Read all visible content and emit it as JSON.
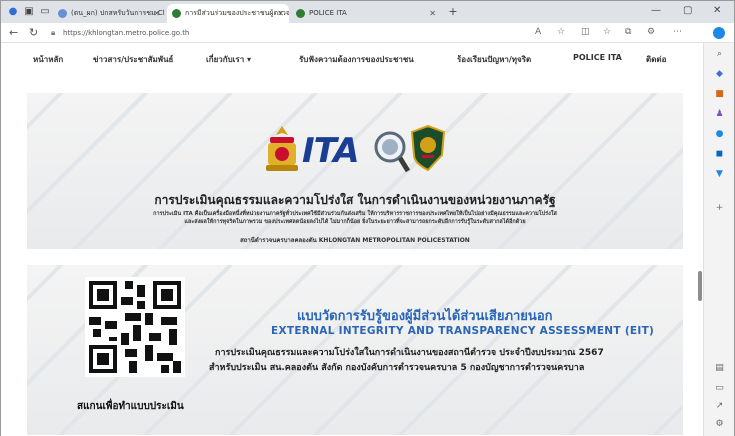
{
  "browser": {
    "tabs": [
      {
        "title": "(ตน_ผก) ปกสหรับวันการชม Cl:",
        "active": false,
        "favicon_color": "#6b8fd6"
      },
      {
        "title": "การมีส่วนร่วมของประชาชนผู้ตรวจสอบผล",
        "active": true,
        "favicon_color": "#2e7d32"
      },
      {
        "title": "POLICE ITA",
        "active": false,
        "favicon_color": "#2e7d32"
      }
    ],
    "url": "https://khlongtan.metro.police.go.th",
    "new_tab_symbol": "+"
  },
  "menu": {
    "items": [
      "หน้าหลัก",
      "ข่าวสาร/ประชาสัมพันธ์",
      "เกี่ยวกับเรา ▾",
      "รับฟังความต้องการของประชาชน",
      "ร้องเรียนปัญหา/ทุจริต",
      "POLICE ITA",
      "ติดต่อ"
    ]
  },
  "banner1": {
    "logo_text": "ITA",
    "title": "การประเมินคุณธรรมและความโปร่งใส ในการดำเนินงานของหน่วยงานภาครัฐ",
    "desc_line1": "การประเมิน ITA คือเป็นเครื่องมือหนึ่งที่หน่วยงานภาครัฐทั่วประเทศใช้มีส่วนร่วมกันส่งเสริม ให้การบริหารราชการของประเทศไทยให้เป็นไปอย่างมีคุณธรรมและความโปร่งใส",
    "desc_line2": "และส่งผลให้การทุจริตในภาพรวม ของประเทศลดน้อยลงไปได้ ไม่มากก็น้อย ยิ่งในระยะยาวที่จะสามารถยกระดับอีกการรับรู้ในระดับสากลได้อีกด้วย",
    "station": "สถานีตำรวจนครบาลคลองตัน   KHLONGTAN METROPOLITAN POLICESTATION"
  },
  "banner2": {
    "qr_caption": "สแกนเพื่อทำแบบประเมิน",
    "title_thai": "แบบวัดการรับรู้ของผู้มีส่วนได้ส่วนเสียภายนอก",
    "title_eng": "EXTERNAL INTEGRITY AND TRANSPARENCY ASSESSMENT (EIT)",
    "line1": "การประเมินคุณธรรมและความโปร่งใสในการดำเนินงานของสถานีตำรวจ ประจำปีงบประมาณ 2567",
    "line2": "สำหรับประเมิน สน.คลองตัน สังกัด กองบังคับการตำรวจนครบาล 5 กองบัญชาการตำรวจนครบาล"
  },
  "colors": {
    "ita_blue": "#1a3e93",
    "eit_blue": "#2a66b5",
    "tab_strip": "#dfe3e8"
  },
  "icons": {
    "sidebar": [
      "search-icon",
      "collections-icon",
      "shopping-icon",
      "people-icon",
      "outlook-icon",
      "office-icon",
      "shopping-bag-icon",
      "add-icon",
      "split-screen-icon",
      "sidebar-toggle-icon",
      "external-link-icon",
      "settings-icon"
    ]
  }
}
